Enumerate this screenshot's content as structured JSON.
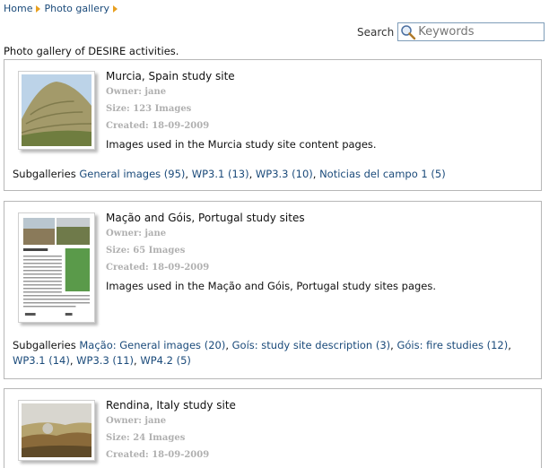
{
  "breadcrumb": {
    "home": "Home",
    "gallery": "Photo gallery"
  },
  "search": {
    "label": "Search",
    "placeholder": "Keywords"
  },
  "intro": "Photo gallery of DESIRE activities.",
  "galleries": [
    {
      "title": "Murcia, Spain study site",
      "owner": "Owner: jane",
      "size": "Size: 123 Images",
      "created": "Created: 18-09-2009",
      "description": "Images used in the Murcia study site content pages.",
      "subgalleries_label": "Subgalleries",
      "subgalleries": [
        "General images (95)",
        "WP3.1 (13)",
        "WP3.3 (10)",
        "Noticias del campo 1 (5)"
      ]
    },
    {
      "title": "Mação and Góis, Portugal study sites",
      "owner": "Owner: jane",
      "size": "Size: 65 Images",
      "created": "Created: 18-09-2009",
      "description": "Images used in the Mação and Góis, Portugal study sites pages.",
      "subgalleries_label": "Subgalleries",
      "subgalleries": [
        "Mação: General images (20)",
        "Goís: study site description (3)",
        "Góis: fire studies (12)",
        "WP3.1 (14)",
        "WP3.3 (11)",
        "WP4.2 (5)"
      ]
    },
    {
      "title": "Rendina, Italy study site",
      "owner": "Owner: jane",
      "size": "Size: 24 Images",
      "created": "Created: 18-09-2009"
    }
  ]
}
